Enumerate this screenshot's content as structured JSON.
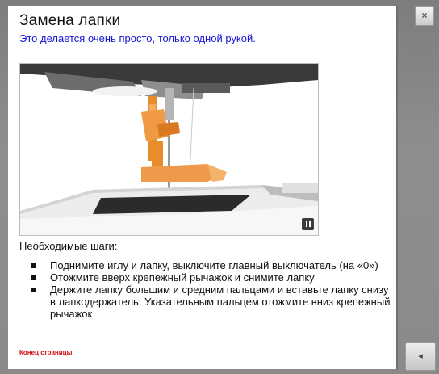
{
  "dialog": {
    "title": "Замена лапки",
    "subtitle": "Это делается очень просто, только одной рукой.",
    "steps_heading": "Необходимые шаги:",
    "steps": [
      "Поднимите иглу и лапку, выключите главный выключатель (на «0»)",
      "Отожмите вверх крепежный рычажок и снимите лапку",
      "Держите лапку большим и средним пальцами и вставьте лапку снизу в лапкодержатель. Указательным пальцем отожмите вниз крепежный рычажок"
    ],
    "page_end": "Конец страницы"
  },
  "controls": {
    "close_glyph": "×",
    "scroll_glyph": "◂",
    "pause_icon": "pause-icon"
  },
  "colors": {
    "subtitle": "#1414d8",
    "page_end": "#d01010",
    "accent_orange": "#e88c2c"
  }
}
